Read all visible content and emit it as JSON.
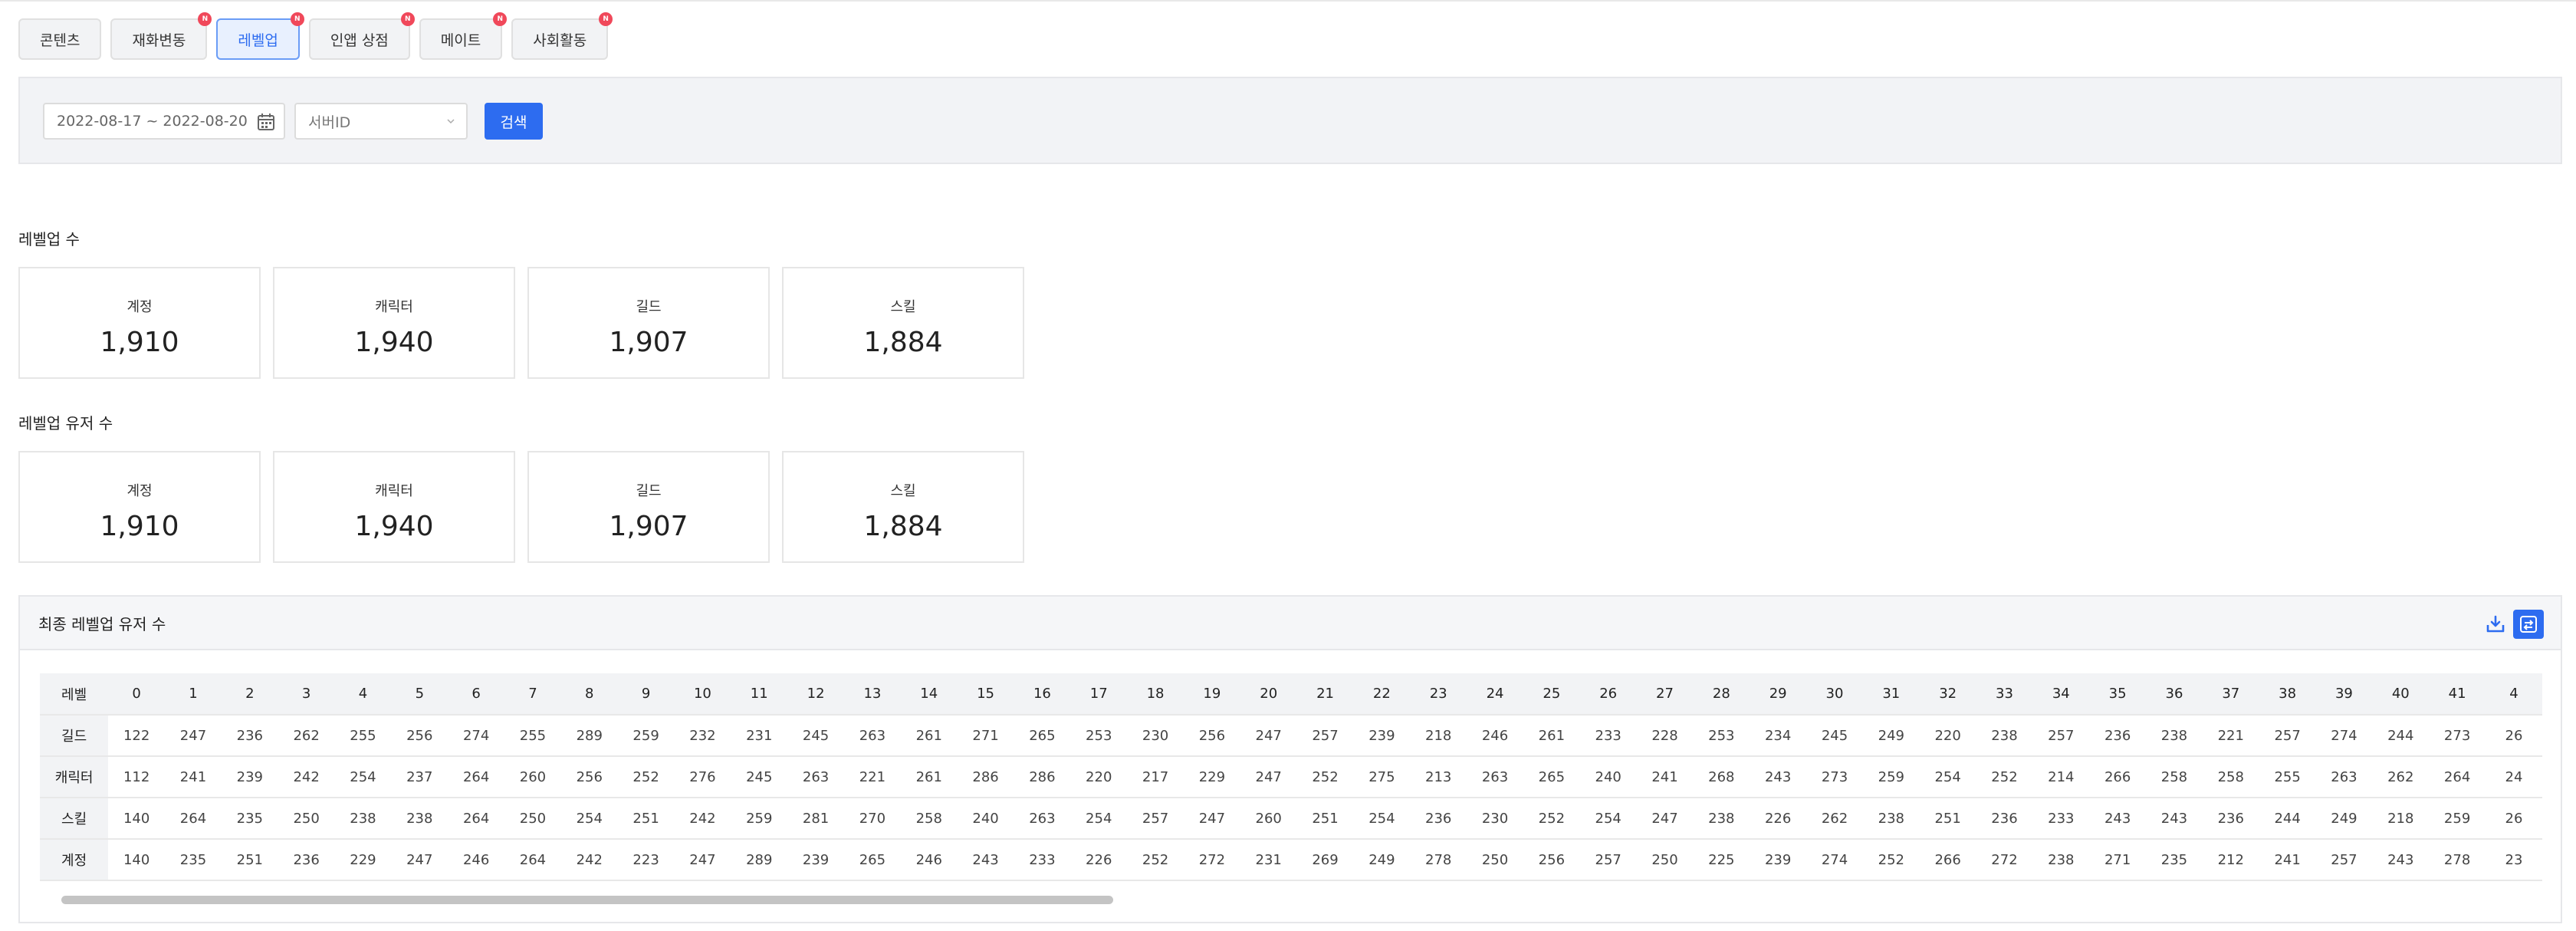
{
  "tabs": [
    {
      "label": "콘텐츠",
      "badge": ""
    },
    {
      "label": "재화변동",
      "badge": "N"
    },
    {
      "label": "레벨업",
      "badge": "N",
      "active": true
    },
    {
      "label": "인앱 상점",
      "badge": "N"
    },
    {
      "label": "메이트",
      "badge": "N"
    },
    {
      "label": "사회활동",
      "badge": "N"
    }
  ],
  "filter": {
    "date_range": "2022-08-17 ~ 2022-08-20",
    "server_placeholder": "서버ID",
    "search_label": "검색"
  },
  "levelup_count": {
    "title": "레벨업 수",
    "cards": [
      {
        "label": "계정",
        "value": "1,910"
      },
      {
        "label": "캐릭터",
        "value": "1,940"
      },
      {
        "label": "길드",
        "value": "1,907"
      },
      {
        "label": "스킬",
        "value": "1,884"
      }
    ]
  },
  "levelup_users": {
    "title": "레벨업 유저 수",
    "cards": [
      {
        "label": "계정",
        "value": "1,910"
      },
      {
        "label": "캐릭터",
        "value": "1,940"
      },
      {
        "label": "길드",
        "value": "1,907"
      },
      {
        "label": "스킬",
        "value": "1,884"
      }
    ]
  },
  "final_table": {
    "title": "최종 레벨업 유저 수",
    "header_label": "레벨",
    "levels": [
      "0",
      "1",
      "2",
      "3",
      "4",
      "5",
      "6",
      "7",
      "8",
      "9",
      "10",
      "11",
      "12",
      "13",
      "14",
      "15",
      "16",
      "17",
      "18",
      "19",
      "20",
      "21",
      "22",
      "23",
      "24",
      "25",
      "26",
      "27",
      "28",
      "29",
      "30",
      "31",
      "32",
      "33",
      "34",
      "35",
      "36",
      "37",
      "38",
      "39",
      "40",
      "41",
      "4"
    ],
    "rows": [
      {
        "label": "길드",
        "values": [
          "122",
          "247",
          "236",
          "262",
          "255",
          "256",
          "274",
          "255",
          "289",
          "259",
          "232",
          "231",
          "245",
          "263",
          "261",
          "271",
          "265",
          "253",
          "230",
          "256",
          "247",
          "257",
          "239",
          "218",
          "246",
          "261",
          "233",
          "228",
          "253",
          "234",
          "245",
          "249",
          "220",
          "238",
          "257",
          "236",
          "238",
          "221",
          "257",
          "274",
          "244",
          "273",
          "26"
        ]
      },
      {
        "label": "캐릭터",
        "values": [
          "112",
          "241",
          "239",
          "242",
          "254",
          "237",
          "264",
          "260",
          "256",
          "252",
          "276",
          "245",
          "263",
          "221",
          "261",
          "286",
          "286",
          "220",
          "217",
          "229",
          "247",
          "252",
          "275",
          "213",
          "263",
          "265",
          "240",
          "241",
          "268",
          "243",
          "273",
          "259",
          "254",
          "252",
          "214",
          "266",
          "258",
          "258",
          "255",
          "263",
          "262",
          "264",
          "24"
        ]
      },
      {
        "label": "스킬",
        "values": [
          "140",
          "264",
          "235",
          "250",
          "238",
          "238",
          "264",
          "250",
          "254",
          "251",
          "242",
          "259",
          "281",
          "270",
          "258",
          "240",
          "263",
          "254",
          "257",
          "247",
          "260",
          "251",
          "254",
          "236",
          "230",
          "252",
          "254",
          "247",
          "238",
          "226",
          "262",
          "238",
          "251",
          "236",
          "233",
          "243",
          "243",
          "236",
          "244",
          "249",
          "218",
          "259",
          "26"
        ]
      },
      {
        "label": "계정",
        "values": [
          "140",
          "235",
          "251",
          "236",
          "229",
          "247",
          "246",
          "264",
          "242",
          "223",
          "247",
          "289",
          "239",
          "265",
          "246",
          "243",
          "233",
          "226",
          "252",
          "272",
          "231",
          "269",
          "249",
          "278",
          "250",
          "256",
          "257",
          "250",
          "225",
          "239",
          "274",
          "252",
          "266",
          "272",
          "238",
          "271",
          "235",
          "212",
          "241",
          "257",
          "243",
          "278",
          "23"
        ]
      }
    ]
  }
}
